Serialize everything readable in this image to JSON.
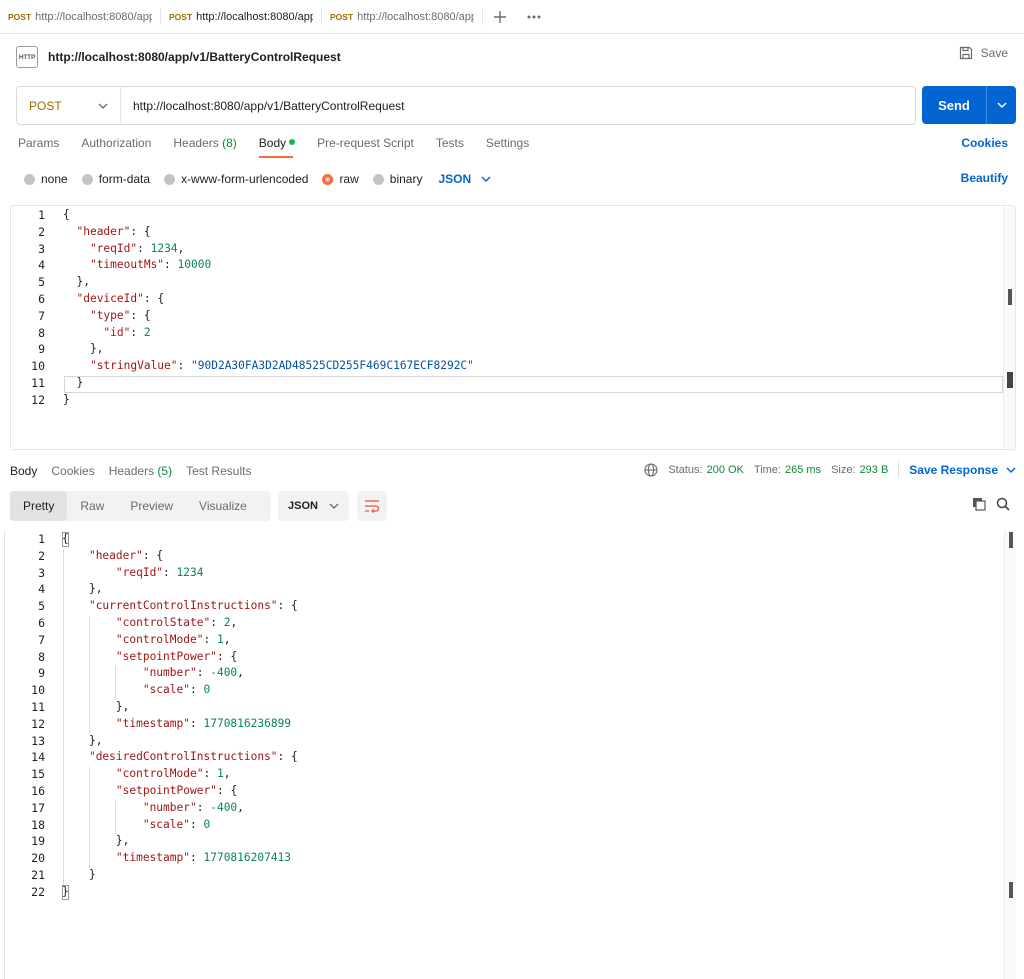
{
  "tabs": [
    {
      "method": "POST",
      "url": "http://localhost:8080/app"
    },
    {
      "method": "POST",
      "url": "http://localhost:8080/app"
    },
    {
      "method": "POST",
      "url": "http://localhost:8080/app"
    }
  ],
  "tab_actions": {
    "add_icon": "plus-icon",
    "more_icon": "ellipsis-icon"
  },
  "request": {
    "title": "http://localhost:8080/app/v1/BatteryControlRequest",
    "save_label": "Save",
    "method": "POST",
    "url": "http://localhost:8080/app/v1/BatteryControlRequest",
    "send_label": "Send"
  },
  "request_tabs": {
    "params": "Params",
    "authorization": "Authorization",
    "headers": "Headers",
    "headers_count": "(8)",
    "body": "Body",
    "pre_request": "Pre-request Script",
    "tests": "Tests",
    "settings": "Settings",
    "cookies": "Cookies"
  },
  "body_types": {
    "none": "none",
    "form_data": "form-data",
    "urlencoded": "x-www-form-urlencoded",
    "raw": "raw",
    "binary": "binary",
    "format": "JSON",
    "beautify": "Beautify",
    "selected": "raw"
  },
  "request_body_lines": [
    "{",
    "  \"header\": {",
    "    \"reqId\": 1234,",
    "    \"timeoutMs\": 10000",
    "  },",
    "  \"deviceId\": {",
    "    \"type\": {",
    "      \"id\": 2",
    "    },",
    "    \"stringValue\": \"90D2A30FA3D2AD48525CD255F469C167ECF8292C\"",
    "  }",
    "}"
  ],
  "response": {
    "tabs": {
      "body": "Body",
      "cookies": "Cookies",
      "headers": "Headers",
      "headers_count": "(5)",
      "test_results": "Test Results"
    },
    "status_label": "Status:",
    "status_value": "200 OK",
    "time_label": "Time:",
    "time_value": "265 ms",
    "size_label": "Size:",
    "size_value": "293 B",
    "save_response": "Save Response",
    "views": {
      "pretty": "Pretty",
      "raw": "Raw",
      "preview": "Preview",
      "visualize": "Visualize"
    },
    "format": "JSON"
  },
  "response_body_lines": [
    "{",
    "    \"header\": {",
    "        \"reqId\": 1234",
    "    },",
    "    \"currentControlInstructions\": {",
    "        \"controlState\": 2,",
    "        \"controlMode\": 1,",
    "        \"setpointPower\": {",
    "            \"number\": -400,",
    "            \"scale\": 0",
    "        },",
    "        \"timestamp\": 1770816236899",
    "    },",
    "    \"desiredControlInstructions\": {",
    "        \"controlMode\": 1,",
    "        \"setpointPower\": {",
    "            \"number\": -400,",
    "            \"scale\": 0",
    "        },",
    "        \"timestamp\": 1770816207413",
    "    }",
    "}"
  ],
  "colors": {
    "accent": "#0265d2",
    "method": "#a06d00",
    "success": "#0e8a3a",
    "active_tab": "#ff6c37"
  }
}
